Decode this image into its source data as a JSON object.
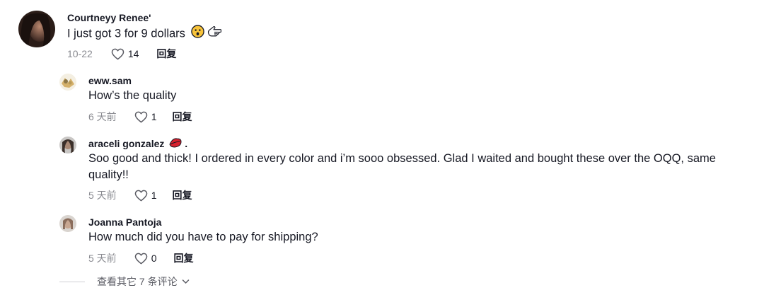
{
  "comments": [
    {
      "username": "Courtneyy Renee'",
      "text": "I just got 3 for 9 dollars",
      "date": "10-22",
      "likes": "14",
      "reply_label": "回复"
    },
    {
      "username": "eww.sam",
      "text": "How’s the quality",
      "date": "6 天前",
      "likes": "1",
      "reply_label": "回复"
    },
    {
      "username": "araceli gonzalez",
      "username_suffix": ".",
      "text": "Soo good and thick! I ordered in every color and i’m sooo obsessed. Glad I waited and bought these over the OQQ, same quality!!",
      "date": "5 天前",
      "likes": "1",
      "reply_label": "回复"
    },
    {
      "username": "Joanna Pantoja",
      "text": "How much did you have to pay for shipping?",
      "date": "5 天前",
      "likes": "0",
      "reply_label": "回复"
    }
  ],
  "view_more_label": "查看其它 7 条评论",
  "icons": {
    "like": "heart-outline-icon",
    "expand": "chevron-down-icon",
    "emoji_1": "astonished-face-emoji",
    "emoji_2": "pointing-hand-emoji",
    "emoji_3": "lips-emoji"
  },
  "colors": {
    "text": "#161823",
    "secondary": "#8a8b91"
  }
}
